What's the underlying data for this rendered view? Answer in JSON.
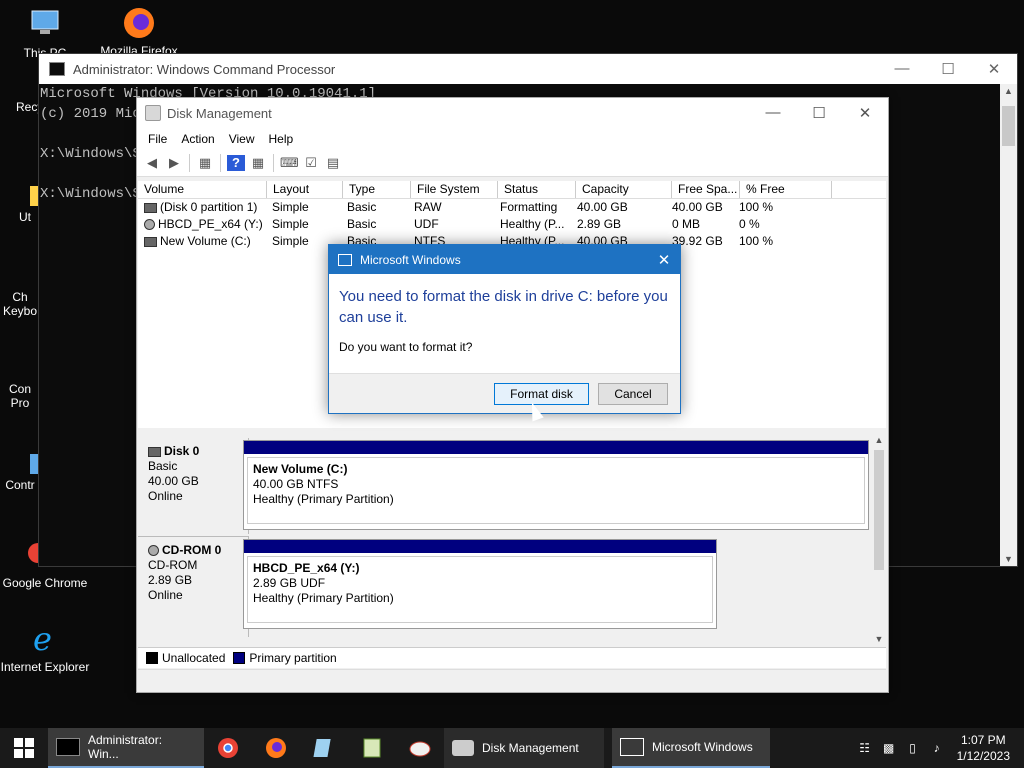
{
  "desktop": {
    "icons": [
      {
        "label": "This PC"
      },
      {
        "label": "Mozilla Firefox"
      },
      {
        "label": "Recy"
      },
      {
        "label": "Ut"
      },
      {
        "label": "Ch\nKeybo"
      },
      {
        "label": "Con\nPro"
      },
      {
        "label": "Contr"
      },
      {
        "label": "Google Chrome"
      },
      {
        "label": "Internet Explorer"
      }
    ]
  },
  "cmd": {
    "title": "Administrator: Windows Command Processor",
    "lines": "Microsoft Windows [Version 10.0.19041.1]\n(c) 2019 Mic\n\nX:\\Windows\\S\n\nX:\\Windows\\S"
  },
  "diskmgmt": {
    "title": "Disk Management",
    "menu": [
      "File",
      "Action",
      "View",
      "Help"
    ],
    "columns": [
      "Volume",
      "Layout",
      "Type",
      "File System",
      "Status",
      "Capacity",
      "Free Spa...",
      "% Free"
    ],
    "rows": [
      {
        "volume": "(Disk 0 partition 1)",
        "layout": "Simple",
        "type": "Basic",
        "fs": "RAW",
        "status": "Formatting",
        "capacity": "40.00 GB",
        "free": "40.00 GB",
        "pct": "100 %"
      },
      {
        "volume": "HBCD_PE_x64 (Y:)",
        "layout": "Simple",
        "type": "Basic",
        "fs": "UDF",
        "status": "Healthy (P...",
        "capacity": "2.89 GB",
        "free": "0 MB",
        "pct": "0 %"
      },
      {
        "volume": "New Volume (C:)",
        "layout": "Simple",
        "type": "Basic",
        "fs": "NTFS",
        "status": "Healthy (P...",
        "capacity": "40.00 GB",
        "free": "39.92 GB",
        "pct": "100 %"
      }
    ],
    "disks": [
      {
        "name": "Disk 0",
        "kind": "Basic",
        "size": "40.00 GB",
        "state": "Online",
        "partition": {
          "title": "New Volume  (C:)",
          "fs": "40.00 GB NTFS",
          "health": "Healthy (Primary Partition)"
        }
      },
      {
        "name": "CD-ROM 0",
        "kind": "CD-ROM",
        "size": "2.89 GB",
        "state": "Online",
        "partition": {
          "title": "HBCD_PE_x64  (Y:)",
          "fs": "2.89 GB UDF",
          "health": "Healthy (Primary Partition)"
        }
      }
    ],
    "legend": [
      {
        "label": "Unallocated",
        "color": "#000000"
      },
      {
        "label": "Primary partition",
        "color": "#00007f"
      }
    ]
  },
  "dialog": {
    "title": "Microsoft Windows",
    "main": "You need to format the disk in drive C: before you can use it.",
    "sub": "Do you want to format it?",
    "format_btn": "Format disk",
    "cancel_btn": "Cancel"
  },
  "taskbar": {
    "apps": [
      {
        "label": "Administrator: Win..."
      },
      {
        "label": "Disk Management"
      },
      {
        "label": "Microsoft Windows"
      }
    ],
    "time": "1:07 PM",
    "date": "1/12/2023"
  },
  "colors": {
    "accent": "#1e72c2",
    "partition": "#00007f"
  }
}
